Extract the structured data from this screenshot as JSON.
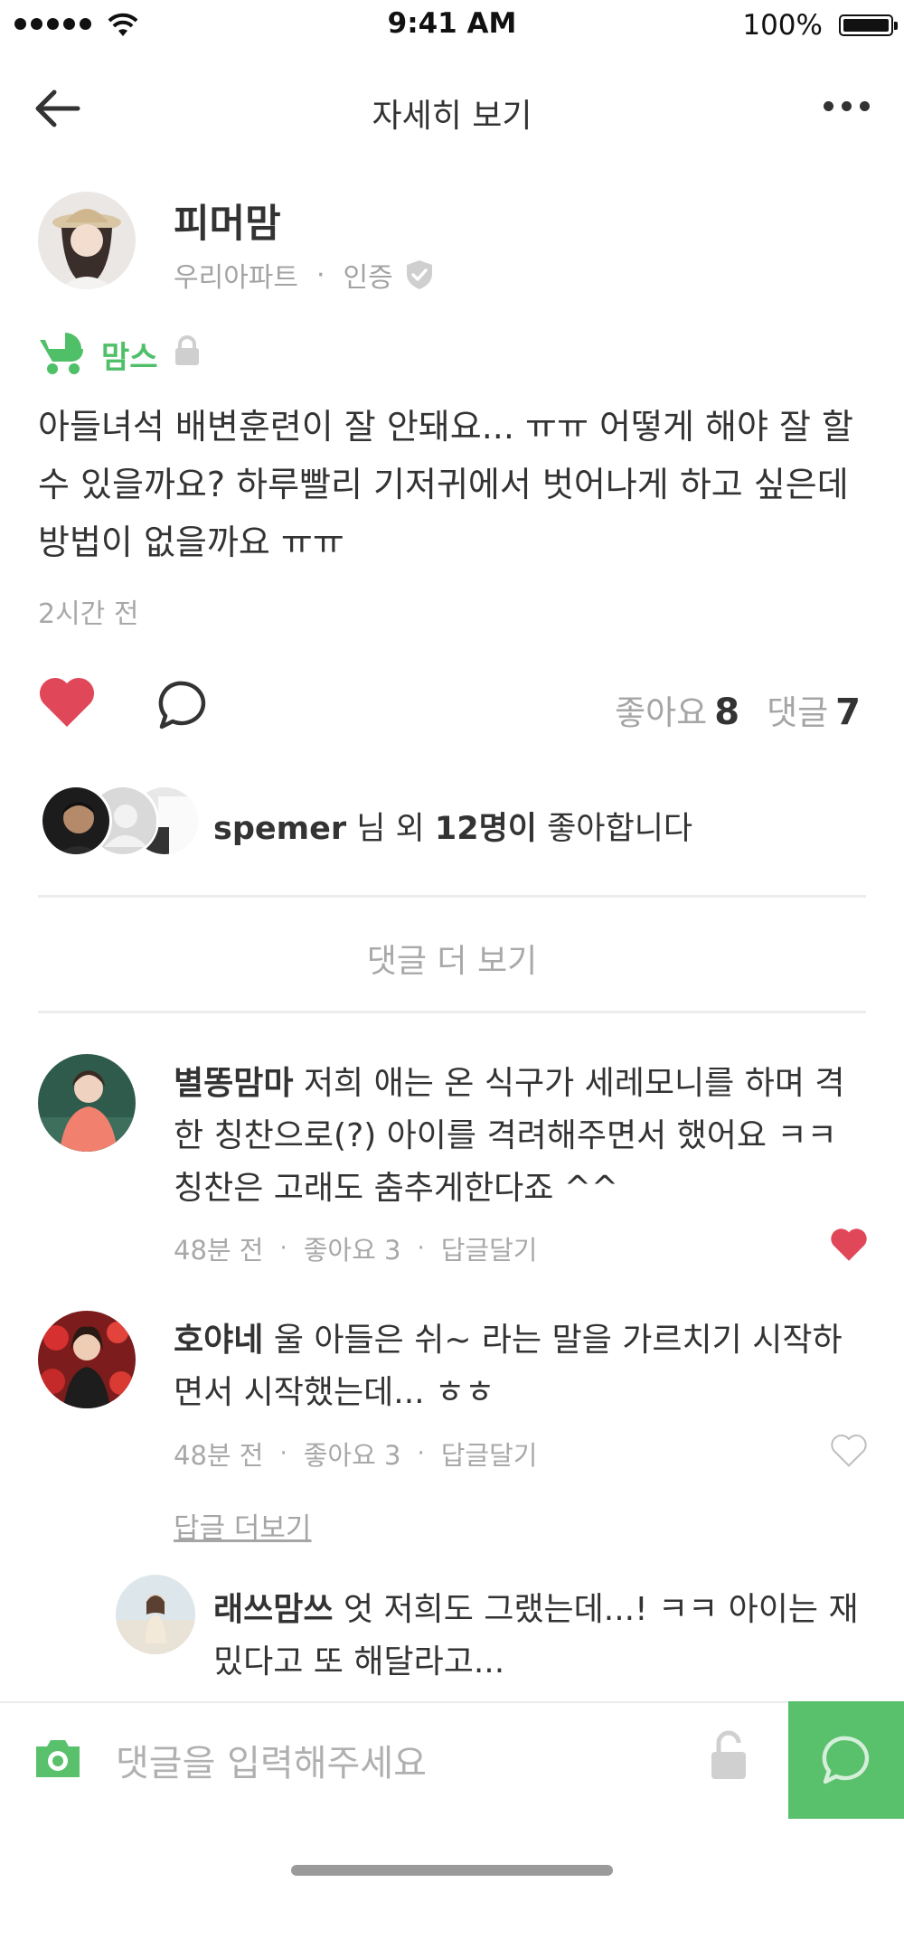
{
  "status_bar": {
    "time": "9:41 AM",
    "battery": "100%"
  },
  "nav": {
    "title": "자세히 보기"
  },
  "post": {
    "author": "피머맘",
    "apartment": "우리아파트",
    "separator": "·",
    "verified_label": "인증",
    "category": "맘스",
    "body": "아들녀석 배변훈련이 잘 안돼요... ㅠㅠ 어떻게 해야 잘 할 수 있을까요? 하루빨리 기저귀에서 벗어나게 하고 싶은데 방법이 없을까요 ㅠㅠ",
    "time": "2시간 전",
    "likes_label": "좋아요",
    "likes_count": "8",
    "comments_label": "댓글",
    "comments_count": "7"
  },
  "likers": {
    "name": "spemer",
    "middle": " 님 외 ",
    "count": "12명이",
    "suffix": " 좋아합니다"
  },
  "more_comments": "댓글 더 보기",
  "comments": [
    {
      "author": "별똥맘마",
      "text": "저희 애는 온 식구가 세레모니를 하며 격한 칭찬으로(?) 아이를 격려해주면서 했어요 ㅋㅋ 칭찬은 고래도 춤추게한다죠 ^^",
      "time": "48분 전",
      "likes": "좋아요 3",
      "reply": "답글달기",
      "liked": true
    },
    {
      "author": "호야네",
      "text": "울 아들은 쉬~ 라는 말을 가르치기 시작하면서 시작했는데... ㅎㅎ",
      "time": "48분 전",
      "likes": "좋아요 3",
      "reply": "답글달기",
      "liked": false
    }
  ],
  "replies_more": "답글 더보기",
  "reply": {
    "author": "래쓰맘쓰",
    "text": "엇 저희도 그랬는데...! ㅋㅋ 아이는 재밌다고 또 해달라고..."
  },
  "input": {
    "placeholder": "댓글을 입력해주세요"
  },
  "colors": {
    "accent": "#59c06c",
    "category": "#4fbf68",
    "heart": "#e0485a",
    "muted": "#a8a8a8"
  },
  "icons": [
    "back-arrow-icon",
    "more-icon",
    "verified-shield-icon",
    "stroller-icon",
    "lock-icon",
    "heart-icon",
    "comment-icon",
    "camera-icon",
    "unlock-icon",
    "send-icon"
  ]
}
